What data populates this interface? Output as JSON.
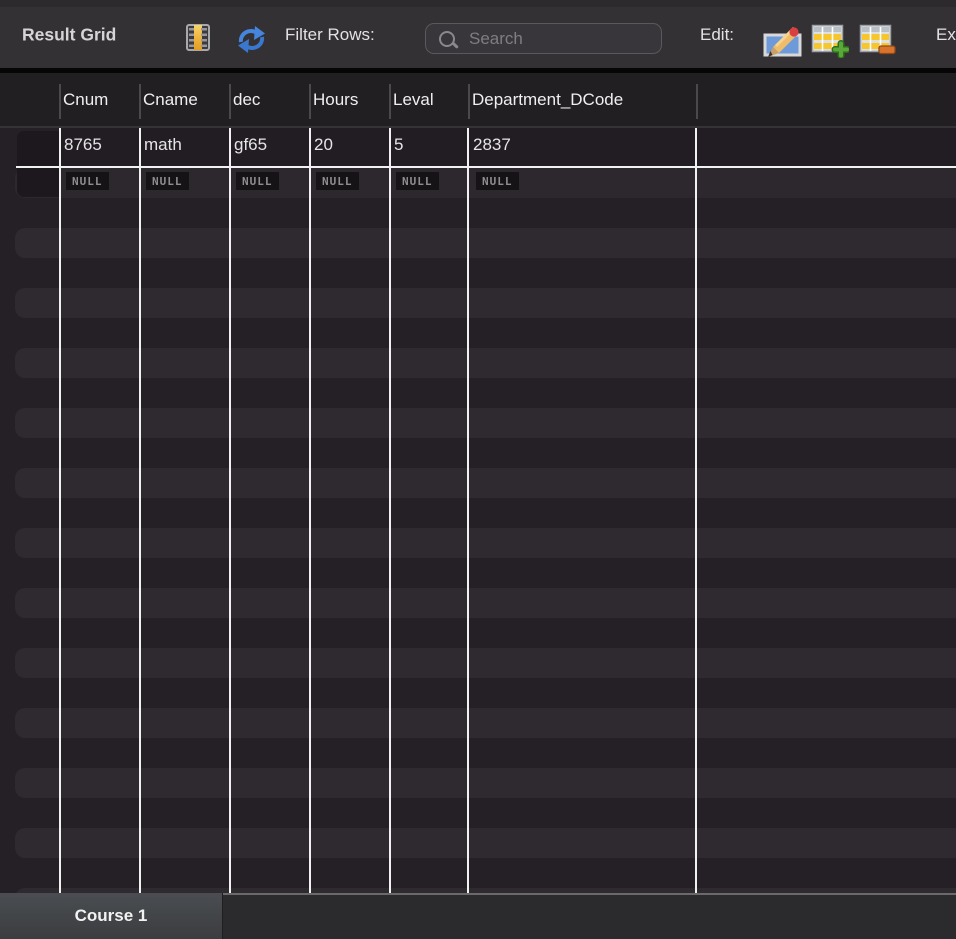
{
  "toolbar": {
    "title": "Result Grid",
    "filter_label": "Filter Rows:",
    "search_placeholder": "Search",
    "edit_label": "Edit:",
    "export_label_partial": "Ex"
  },
  "grid": {
    "columns": [
      "Cnum",
      "Cname",
      "dec",
      "Hours",
      "Leval",
      "Department_DCode"
    ],
    "rows": [
      {
        "values": [
          "8765",
          "math",
          "gf65",
          "20",
          "5",
          "2837"
        ]
      }
    ],
    "null_row": [
      "NULL",
      "NULL",
      "NULL",
      "NULL",
      "NULL",
      "NULL"
    ]
  },
  "result_tabs": [
    {
      "label": "Course 1",
      "active": true
    }
  ],
  "colors": {
    "toolbar_bg": "#343134",
    "header_bg": "#221f23",
    "grid_dark": "#242026",
    "grid_light": "#2e2a2f",
    "row_bg": "#211d22",
    "null_row_bg": "#2c282d",
    "gridline_white": "#f2f1f2",
    "refresh_blue": "#4585dd",
    "grid_icon_yellow": "#eeb23c",
    "insert_green": "#4d9b30",
    "delete_orange": "#d9742e"
  }
}
